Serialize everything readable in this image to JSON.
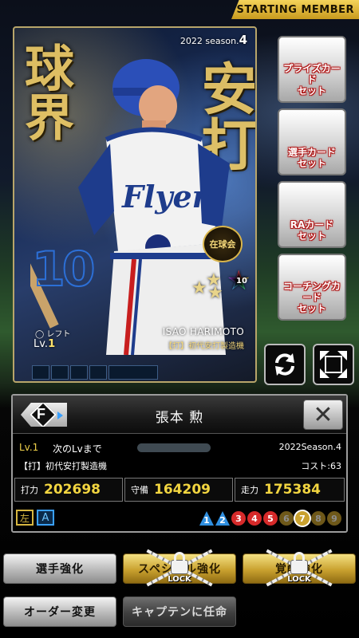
{
  "header": {
    "banner": "STARTING MEMBER"
  },
  "card": {
    "season_label": "2022 season.",
    "season_num": "4",
    "calligraphy_left": "球界",
    "calligraphy_right": "安打",
    "jersey_number": "10",
    "position": "◯ レフト",
    "level_label": "Lv.",
    "level_value": "1",
    "player_name_en": "ISAO HARIMOTO",
    "title_tag": "【打】初代安打製造機",
    "emblem_text": "在球会",
    "star_level": "10",
    "stats": [
      {
        "label": "打",
        "value": "202698"
      },
      {
        "label": "守",
        "value": "164209"
      },
      {
        "label": "走",
        "value": "175384"
      }
    ]
  },
  "side_buttons": [
    {
      "label": "プライズカード\nセット"
    },
    {
      "label": "選手カード\nセット"
    },
    {
      "label": "RAカード\nセット"
    },
    {
      "label": "コーチングカード\nセット"
    }
  ],
  "panel": {
    "position_letter": "F",
    "name": "張本 勲",
    "close": "✕",
    "level": "Lv.1",
    "next_level": "次のLvまで",
    "xp_progress": 0.0,
    "season": "2022Season.4",
    "title": "【打】初代安打製造機",
    "cost": "コスト:63",
    "stats": [
      {
        "key": "打力",
        "value": "202698"
      },
      {
        "key": "守備",
        "value": "164209"
      },
      {
        "key": "走力",
        "value": "175384"
      }
    ],
    "bats": "左",
    "throws": "A",
    "grades": [
      {
        "v": "1",
        "shape": "tri",
        "color": "#2f8fe0",
        "dim": false
      },
      {
        "v": "2",
        "shape": "tri",
        "color": "#2f8fe0",
        "dim": false
      },
      {
        "v": "3",
        "shape": "ci",
        "color": "#d62a2a",
        "dim": false
      },
      {
        "v": "4",
        "shape": "ci",
        "color": "#d62a2a",
        "dim": false
      },
      {
        "v": "5",
        "shape": "ci",
        "color": "#d62a2a",
        "dim": false
      },
      {
        "v": "6",
        "shape": "ci",
        "color": "#c9a12f",
        "dim": true
      },
      {
        "v": "7",
        "shape": "ci",
        "color": "#c9a12f",
        "dim": false
      },
      {
        "v": "8",
        "shape": "ci",
        "color": "#c9a12f",
        "dim": true
      },
      {
        "v": "9",
        "shape": "ci",
        "color": "#c9a12f",
        "dim": true
      }
    ]
  },
  "bottom": {
    "enhance": "選手強化",
    "special": "スペシャル強化",
    "awaken": "覚醒強化",
    "lock_text": "LOCK",
    "order": "オーダー変更",
    "captain": "キャプテンに任命"
  },
  "colors": {
    "gold": "#c9a12f",
    "stat_yellow": "#f2d540",
    "accent_blue": "#3aa0ff"
  }
}
